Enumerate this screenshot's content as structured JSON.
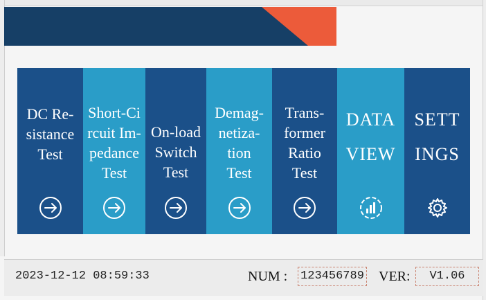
{
  "tiles": [
    {
      "label": "DC Re-\nsistance\nTest",
      "icon": "arrow-right-circle-icon",
      "color": "#1b5089",
      "style": "normal"
    },
    {
      "label": "Short-Ci\nrcuit Im-\npedance\nTest",
      "icon": "arrow-right-circle-icon",
      "color": "#2a9dc8",
      "style": "normal"
    },
    {
      "label": "On-load\nSwitch\nTest",
      "icon": "arrow-right-circle-icon",
      "color": "#1b5089",
      "style": "normal"
    },
    {
      "label": "Demag-\nnetiza-\ntion\nTest",
      "icon": "arrow-right-circle-icon",
      "color": "#2a9dc8",
      "style": "normal"
    },
    {
      "label": "Trans-\nformer\nRatio\nTest",
      "icon": "arrow-right-circle-icon",
      "color": "#1b5089",
      "style": "normal"
    },
    {
      "label": "DATA\nVIEW",
      "icon": "data-chart-icon",
      "color": "#2a9dc8",
      "style": "big"
    },
    {
      "label": "SETT\nINGS",
      "icon": "gear-icon",
      "color": "#1b5089",
      "style": "big"
    }
  ],
  "status": {
    "datetime": "2023-12-12 08:59:33",
    "num_label": "NUM :",
    "num_value": "123456789",
    "ver_label": "VER:",
    "ver_value": "V1.06"
  },
  "colors": {
    "header_dark": "#163f66",
    "header_accent": "#ec5b3a",
    "tile_dark": "#1b5089",
    "tile_light": "#2a9dc8"
  }
}
